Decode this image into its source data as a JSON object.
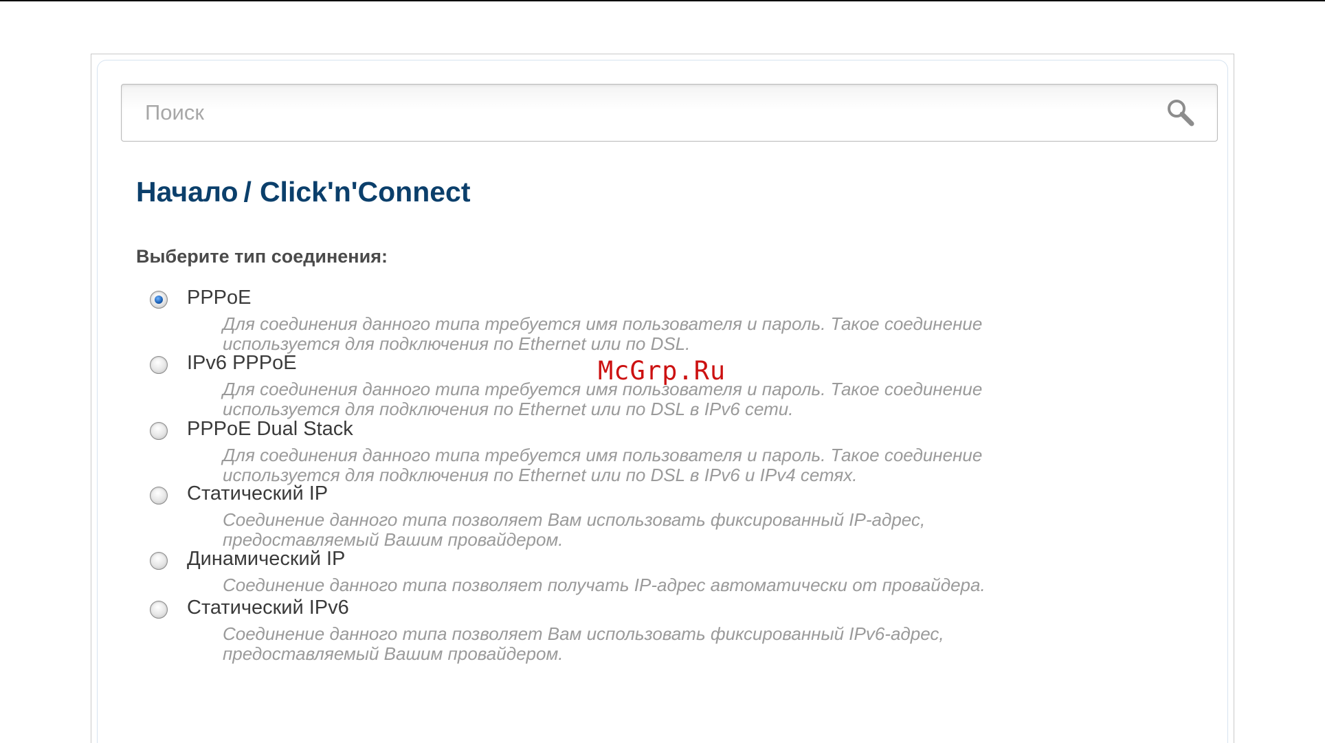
{
  "search": {
    "placeholder": "Поиск"
  },
  "breadcrumb": {
    "home": "Начало",
    "separator": "/",
    "current": "Click'n'Connect"
  },
  "section_label": "Выберите тип соединения:",
  "connection_types": [
    {
      "label": "PPPoE",
      "checked": true,
      "description_line1": "Для соединения данного типа требуется имя пользователя и пароль. Такое соединение",
      "description_line2": "используется для подключения по Ethernet или по DSL."
    },
    {
      "label": "IPv6 PPPoE",
      "checked": false,
      "description_line1": "Для соединения данного типа требуется имя пользователя и пароль. Такое соединение",
      "description_line2": "используется для подключения по Ethernet или по DSL в IPv6 сети."
    },
    {
      "label": "PPPoE Dual Stack",
      "checked": false,
      "description_line1": "Для соединения данного типа требуется имя пользователя и пароль. Такое соединение",
      "description_line2": "используется для подключения по Ethernet или по DSL в IPv6 и IPv4 сетях."
    },
    {
      "label": "Статический IP",
      "checked": false,
      "description_line1": "Соединение данного типа позволяет Вам использовать фиксированный IP-адрес,",
      "description_line2": "предоставляемый Вашим провайдером."
    },
    {
      "label": "Динамический IP",
      "checked": false,
      "description_line1": "Соединение данного типа позволяет получать IP-адрес автоматически от провайдера.",
      "description_line2": ""
    },
    {
      "label": "Статический IPv6",
      "checked": false,
      "description_line1": "Соединение данного типа позволяет Вам использовать фиксированный IPv6-адрес,",
      "description_line2": "предоставляемый Вашим провайдером."
    }
  ],
  "watermark": "McGrp.Ru",
  "colors": {
    "breadcrumb": "#0b3f6b",
    "description": "#9a9a9a",
    "radio_selected": "#1a5fb4"
  },
  "icons": {
    "search": "search-icon"
  }
}
